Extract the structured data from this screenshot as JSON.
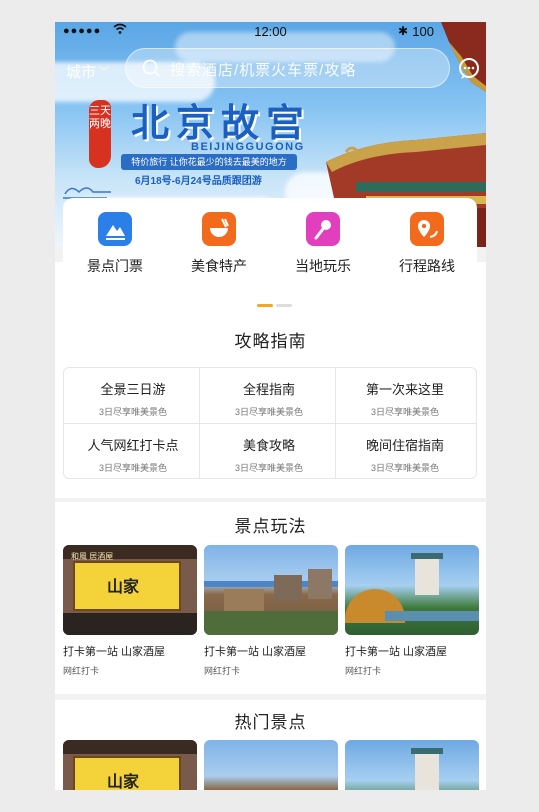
{
  "status_bar": {
    "signal": "●●●●●",
    "time": "12:00",
    "battery": "100"
  },
  "header": {
    "city_label": "城市",
    "search_placeholder": "搜索酒店/机票火车票/攻略"
  },
  "banner": {
    "seal_text": "三天两晚",
    "title": "北京故宫",
    "pinyin": "BEIJINGGUGONG",
    "slogan": "特价旅行 让你花最少的钱去最美的地方",
    "dates": "6月18号-6月24号品质跟团游"
  },
  "categories": [
    {
      "label": "景点门票",
      "icon": "mountain-ticket-icon",
      "color": "#2a7fe8"
    },
    {
      "label": "美食特产",
      "icon": "food-bowl-icon",
      "color": "#f26a1b"
    },
    {
      "label": "当地玩乐",
      "icon": "microphone-icon",
      "color": "#e23fbf"
    },
    {
      "label": "行程路线",
      "icon": "route-pin-icon",
      "color": "#f26a1b"
    }
  ],
  "guide": {
    "title": "攻略指南",
    "items": [
      {
        "title": "全景三日游",
        "sub": "3日尽享唯美景色"
      },
      {
        "title": "全程指南",
        "sub": "3日尽享唯美景色"
      },
      {
        "title": "第一次来这里",
        "sub": "3日尽享唯美景色"
      },
      {
        "title": "人气网红打卡点",
        "sub": "3日尽享唯美景色"
      },
      {
        "title": "美食攻略",
        "sub": "3日尽享唯美景色"
      },
      {
        "title": "晚间住宿指南",
        "sub": "3日尽享唯美景色"
      }
    ]
  },
  "spots": {
    "title": "景点玩法",
    "cards": [
      {
        "title": "打卡第一站 山家酒屋",
        "tag": "网红打卡"
      },
      {
        "title": "打卡第一站 山家酒屋",
        "tag": "网红打卡"
      },
      {
        "title": "打卡第一站 山家酒屋",
        "tag": "网红打卡"
      }
    ],
    "sign_text": "山家",
    "sign_top": "和風 居酒屋"
  },
  "hot": {
    "title": "热门景点"
  },
  "colors": {
    "accent_orange": "#f5a623",
    "primary_blue": "#1b5fbf"
  }
}
